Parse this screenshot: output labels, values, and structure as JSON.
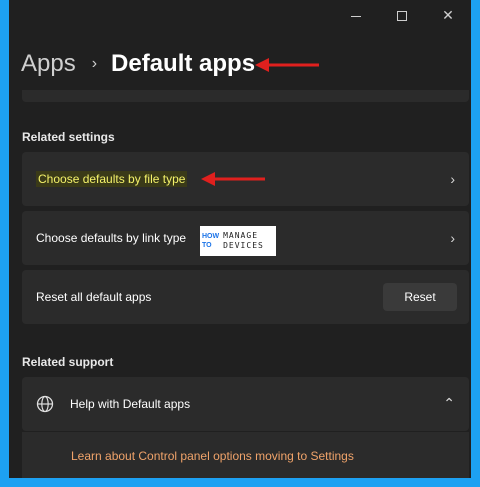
{
  "window": {
    "title_buttons": {
      "minimize": "minimize-icon",
      "maximize": "maximize-icon",
      "close": "close-icon"
    }
  },
  "breadcrumb": {
    "parent": "Apps",
    "separator": "›",
    "current": "Default apps"
  },
  "related_settings": {
    "heading": "Related settings",
    "items": [
      {
        "label": "Choose defaults by file type",
        "icon": "chevron-right-icon"
      },
      {
        "label": "Choose defaults by link type",
        "icon": "chevron-right-icon"
      },
      {
        "label": "Reset all default apps",
        "button": "Reset"
      }
    ]
  },
  "watermark": {
    "how": "HOW",
    "to": "TO",
    "manage": "MANAGE",
    "devices": "DEVICES"
  },
  "related_support": {
    "heading": "Related support",
    "item_label": "Help with Default apps",
    "link": "Learn about Control panel options moving to Settings"
  },
  "colors": {
    "background": "#202020",
    "card": "#2b2b2b",
    "accent_arrow": "#e0201e",
    "highlight": "#e0e000",
    "link": "#f0a36a",
    "frame": "#1da1f2"
  }
}
